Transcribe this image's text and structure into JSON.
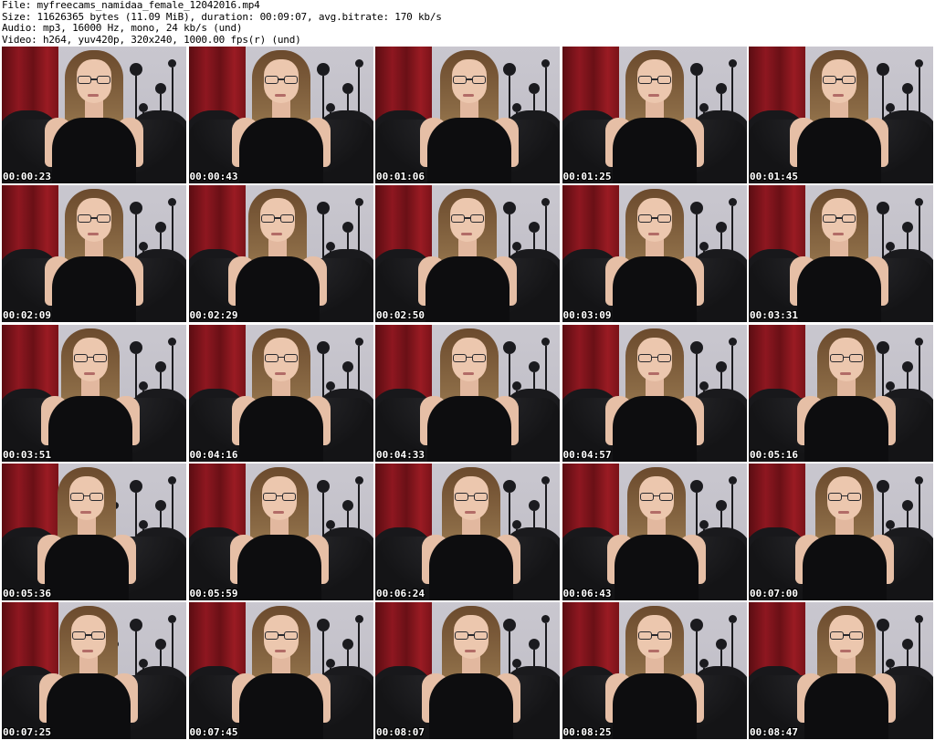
{
  "header": {
    "file_line": "File: myfreecams_namidaa_female_12042016.mp4",
    "size_line": "Size: 11626365 bytes (11.09 MiB), duration: 00:09:07, avg.bitrate: 170 kb/s",
    "audio_line": "Audio: mp3, 16000 Hz, mono, 24 kb/s (und)",
    "video_line": "Video: h264, yuv420p, 320x240, 1000.00 fps(r) (und)"
  },
  "thumbnails": [
    {
      "time": "00:00:23"
    },
    {
      "time": "00:00:43"
    },
    {
      "time": "00:01:06"
    },
    {
      "time": "00:01:25"
    },
    {
      "time": "00:01:45"
    },
    {
      "time": "00:02:09"
    },
    {
      "time": "00:02:29"
    },
    {
      "time": "00:02:50"
    },
    {
      "time": "00:03:09"
    },
    {
      "time": "00:03:31"
    },
    {
      "time": "00:03:51"
    },
    {
      "time": "00:04:16"
    },
    {
      "time": "00:04:33"
    },
    {
      "time": "00:04:57"
    },
    {
      "time": "00:05:16"
    },
    {
      "time": "00:05:36"
    },
    {
      "time": "00:05:59"
    },
    {
      "time": "00:06:24"
    },
    {
      "time": "00:06:43"
    },
    {
      "time": "00:07:00"
    },
    {
      "time": "00:07:25"
    },
    {
      "time": "00:07:45"
    },
    {
      "time": "00:08:07"
    },
    {
      "time": "00:08:25"
    },
    {
      "time": "00:08:47"
    }
  ]
}
